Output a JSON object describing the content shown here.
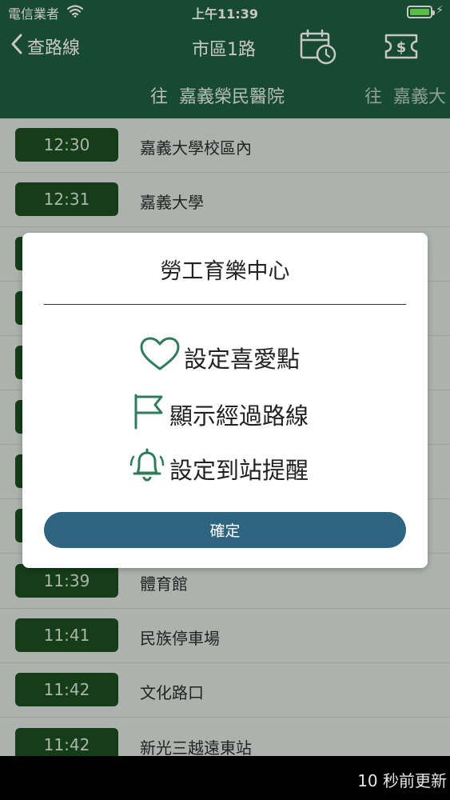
{
  "status_bar": {
    "carrier": "電信業者",
    "time": "上午11:39"
  },
  "nav": {
    "back_label": "查路線",
    "title": "市區1路"
  },
  "direction_tabs": [
    {
      "prefix": "往",
      "name": "嘉義榮民醫院"
    },
    {
      "prefix": "往",
      "name": "嘉義大"
    }
  ],
  "rows": [
    {
      "time": "12:30",
      "stop": "嘉義大學校區內"
    },
    {
      "time": "12:31",
      "stop": "嘉義大學"
    },
    {
      "time": "",
      "stop": ""
    },
    {
      "time": "",
      "stop": ""
    },
    {
      "time": "",
      "stop": ""
    },
    {
      "time": "",
      "stop": ""
    },
    {
      "time": "",
      "stop": ""
    },
    {
      "time": "",
      "stop": ""
    },
    {
      "time": "11:39",
      "stop": "體育館"
    },
    {
      "time": "11:41",
      "stop": "民族停車場"
    },
    {
      "time": "11:42",
      "stop": "文化路口"
    },
    {
      "time": "11:42",
      "stop": "新光三越遠東站"
    }
  ],
  "modal": {
    "title": "勞工育樂中心",
    "options": {
      "favorite": "設定喜愛點",
      "route": "顯示經過路線",
      "alert": "設定到站提醒"
    },
    "confirm": "確定"
  },
  "footer": {
    "update_text": "10 秒前更新"
  },
  "colors": {
    "header_green": "#1e5f3e",
    "pill_green": "#1b4f1f",
    "icon_green": "#2e7c5a",
    "confirm_blue": "#2d6581"
  }
}
